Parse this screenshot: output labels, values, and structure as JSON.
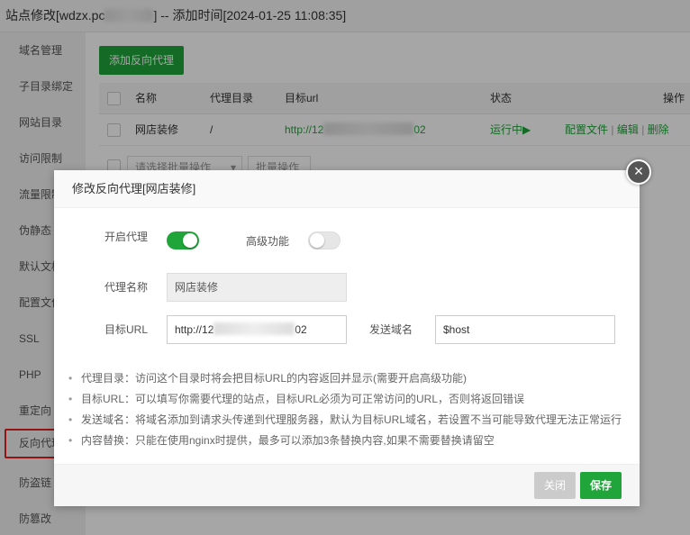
{
  "window": {
    "title_prefix": "站点修改[wdzx.pc",
    "title_suffix": "] -- 添加时间[2024-01-25 11:08:35]"
  },
  "sidebar": {
    "items": [
      "域名管理",
      "子目录绑定",
      "网站目录",
      "访问限制",
      "流量限制",
      "伪静态",
      "默认文档",
      "配置文件",
      "SSL",
      "PHP",
      "重定向",
      "反向代理",
      "防盗链",
      "防篡改"
    ]
  },
  "main": {
    "add_button": "添加反向代理",
    "columns": {
      "name": "名称",
      "proxy_dir": "代理目录",
      "target_url": "目标url",
      "status": "状态",
      "actions": "操作"
    },
    "row": {
      "name": "网店装修",
      "proxy_dir": "/",
      "target_prefix": "http://12",
      "target_suffix": "02",
      "status": "运行中▶",
      "action_config": "配置文件",
      "action_edit": "编辑",
      "action_delete": "删除",
      "separator": "|"
    },
    "batch_select": "请选择批量操作",
    "batch_button": "批量操作"
  },
  "modal": {
    "title": "修改反向代理[网店装修]",
    "close": "×",
    "enable_label": "开启代理",
    "advanced_label": "高级功能",
    "enable_on": true,
    "advanced_on": false,
    "name_label": "代理名称",
    "name_value": "网店装修",
    "url_label": "目标URL",
    "url_prefix": "http://12",
    "url_suffix": "02",
    "send_domain_label": "发送域名",
    "send_domain_value": "$host",
    "tips": [
      "代理目录：访问这个目录时将会把目标URL的内容返回并显示(需要开启高级功能)",
      "目标URL：可以填写你需要代理的站点，目标URL必须为可正常访问的URL，否则将返回错误",
      "发送域名：将域名添加到请求头传递到代理服务器，默认为目标URL域名，若设置不当可能导致代理无法正常运行",
      "内容替换：只能在使用nginx时提供，最多可以添加3条替换内容,如果不需要替换请留空"
    ],
    "cancel_button": "关闭",
    "save_button": "保存"
  },
  "colors": {
    "accent": "#20a53a",
    "highlight_border": "#e02020"
  }
}
